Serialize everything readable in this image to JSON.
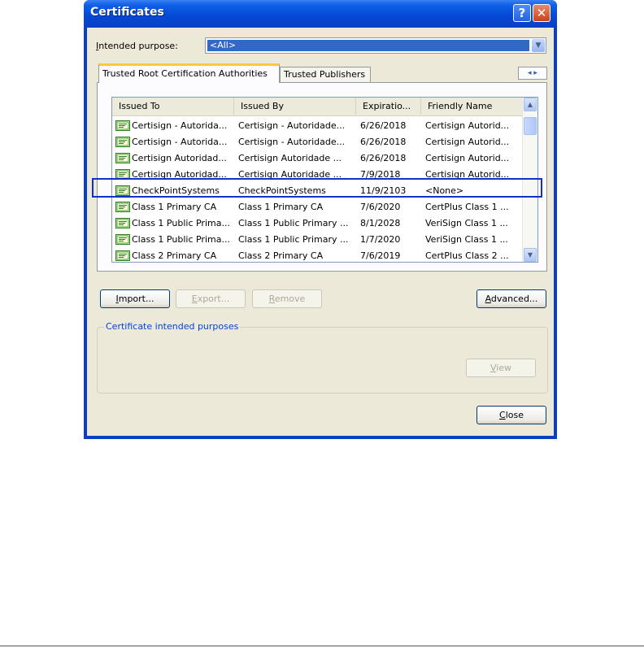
{
  "window": {
    "title": "Certificates"
  },
  "titlebar_buttons": {
    "help": "?",
    "close": "✕"
  },
  "intended_purpose": {
    "label_first": "I",
    "label_rest": "ntended purpose:",
    "value": "<All>"
  },
  "tabs": [
    {
      "label": "Trusted Root Certification Authorities",
      "active": true
    },
    {
      "label": "Trusted Publishers",
      "active": false
    }
  ],
  "tab_scroll": "◂ ▸",
  "columns": [
    "Issued To",
    "Issued By",
    "Expiratio...",
    "Friendly Name"
  ],
  "rows": [
    {
      "issued_to": "Certisign - Autorida...",
      "issued_by": "Certisign - Autoridade...",
      "expiration": "6/26/2018",
      "friendly_name": "Certisign Autorid..."
    },
    {
      "issued_to": "Certisign - Autorida...",
      "issued_by": "Certisign - Autoridade...",
      "expiration": "6/26/2018",
      "friendly_name": "Certisign Autorid..."
    },
    {
      "issued_to": "Certisign Autoridad...",
      "issued_by": "Certisign Autoridade ...",
      "expiration": "6/26/2018",
      "friendly_name": "Certisign Autorid..."
    },
    {
      "issued_to": "Certisign Autoridad...",
      "issued_by": "Certisign Autoridade ...",
      "expiration": "7/9/2018",
      "friendly_name": "Certisign Autorid..."
    },
    {
      "issued_to": "CheckPointSystems",
      "issued_by": "CheckPointSystems",
      "expiration": "11/9/2103",
      "friendly_name": "<None>"
    },
    {
      "issued_to": "Class 1 Primary CA",
      "issued_by": "Class 1 Primary CA",
      "expiration": "7/6/2020",
      "friendly_name": "CertPlus Class 1 ..."
    },
    {
      "issued_to": "Class 1 Public Prima...",
      "issued_by": "Class 1 Public Primary ...",
      "expiration": "8/1/2028",
      "friendly_name": "VeriSign Class 1 ..."
    },
    {
      "issued_to": "Class 1 Public Prima...",
      "issued_by": "Class 1 Public Primary ...",
      "expiration": "1/7/2020",
      "friendly_name": "VeriSign Class 1 ..."
    },
    {
      "issued_to": "Class 2 Primary CA",
      "issued_by": "Class 2 Primary CA",
      "expiration": "7/6/2019",
      "friendly_name": "CertPlus Class 2 ..."
    }
  ],
  "buttons": {
    "import": {
      "first": "I",
      "rest": "mport..."
    },
    "export": {
      "first": "E",
      "rest": "xport..."
    },
    "remove": {
      "first": "R",
      "rest": "emove"
    },
    "advanced": {
      "first": "A",
      "rest": "dvanced..."
    },
    "view": {
      "first": "V",
      "rest": "iew"
    },
    "close": {
      "first": "C",
      "rest": "lose"
    }
  },
  "purposes_group": {
    "title": "Certificate intended purposes"
  },
  "colors": {
    "highlight_box": "#1530c8",
    "selection": "#316ac5",
    "titlebar": "#0548d4"
  },
  "icons": {
    "cert": "certificate-icon"
  }
}
